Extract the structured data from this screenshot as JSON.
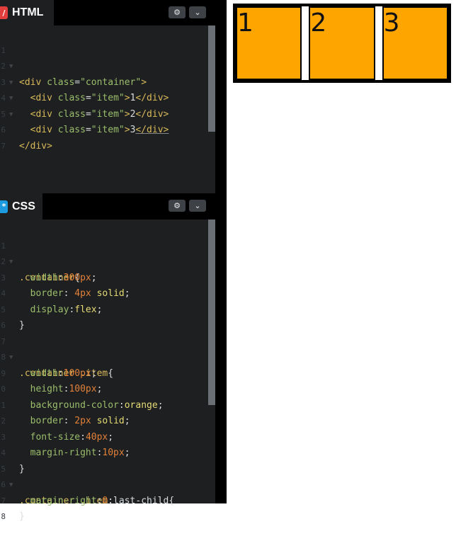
{
  "html_panel": {
    "badge": "/",
    "label": "HTML",
    "badge_color": "#e33e3e",
    "settings_icon": "gear-icon",
    "collapse_icon": "chevron-down-icon",
    "line_numbers": [
      "1",
      "2",
      "3",
      "4",
      "5",
      "6",
      "7"
    ],
    "lines": [
      "<div class=\"container\">",
      "  <div class=\"item\">1</div>",
      "  <div class=\"item\">2</div>",
      "  <div class=\"item\">3</div>",
      "",
      "</div>",
      ""
    ]
  },
  "css_panel": {
    "badge": "*",
    "label": "CSS",
    "badge_color": "#1e9be0",
    "settings_icon": "gear-icon",
    "collapse_icon": "chevron-down-icon",
    "line_numbers": [
      "1",
      "2",
      "3",
      "4",
      "5",
      "6",
      "7",
      "8",
      "9",
      "0",
      "1",
      "2",
      "3",
      "4",
      "5",
      "6",
      "7",
      "8"
    ],
    "lines": [
      ".container{",
      "  width:300px;",
      "  border: 4px solid;",
      "  display:flex;",
      "}",
      "",
      ".container .item{",
      "  width:100px;",
      "  height:100px;",
      "  background-color:orange;",
      "  border: 2px solid;",
      "  font-size:40px;",
      "  margin-right:10px;",
      "}",
      ".container .item:last-child{",
      "  margin-right:0;",
      "}",
      ""
    ]
  },
  "result": {
    "items": [
      "1",
      "2",
      "3"
    ],
    "item_color": "#ffa500"
  }
}
